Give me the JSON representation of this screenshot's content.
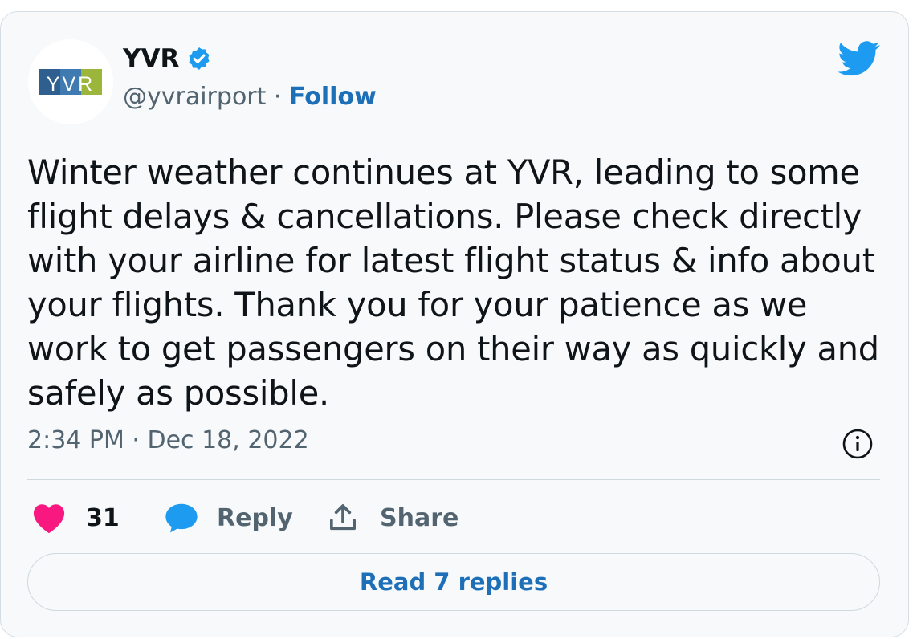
{
  "account": {
    "name": "YVR",
    "handle": "@yvrairport",
    "separator": " · ",
    "follow_label": "Follow",
    "logo_text": "YVR",
    "verified": true
  },
  "tweet": {
    "text": "Winter weather continues at YVR, leading to some flight delays & cancellations. Please check directly with your airline for latest flight status & info about your flights. Thank you for your patience as we work to get passengers on their way as quickly and safely as possible.",
    "timestamp": "2:34 PM · Dec 18, 2022"
  },
  "actions": {
    "like_count": "31",
    "reply_label": "Reply",
    "share_label": "Share"
  },
  "read_replies_label": "Read 7 replies",
  "colors": {
    "like": "#f91880",
    "reply_icon": "#1d9bf0",
    "link": "#1d6fb8",
    "twitter_bird": "#1d9bf0",
    "verified_badge": "#1d9bf0",
    "logo_blue": "#2f5f8f",
    "logo_green": "#9cb63c"
  },
  "icons": {
    "bird": "twitter-bird-icon",
    "verified": "verified-badge-icon",
    "info": "info-icon",
    "like": "heart-icon",
    "reply": "speech-bubble-icon",
    "share": "share-upload-icon"
  }
}
